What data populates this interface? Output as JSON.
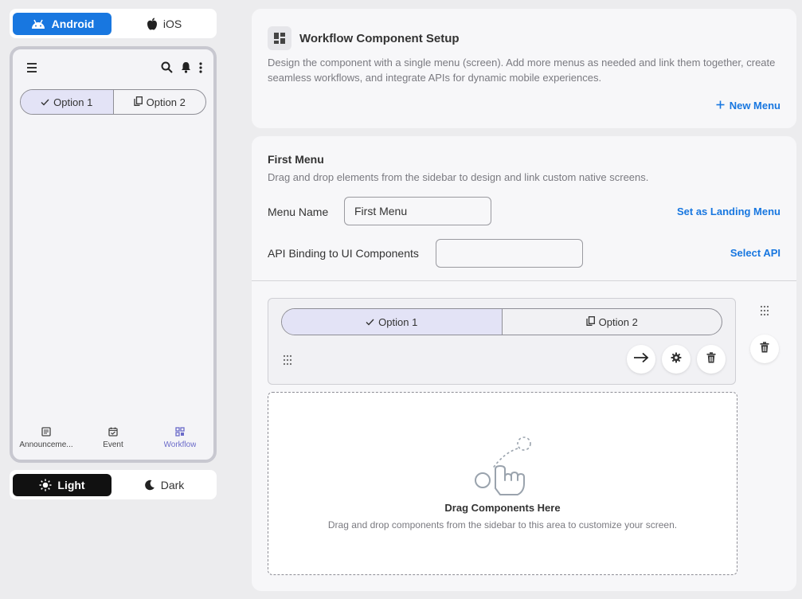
{
  "platform": {
    "android_label": "Android",
    "ios_label": "iOS",
    "selected": "Android"
  },
  "preview": {
    "tabs": [
      "Option 1",
      "Option 2"
    ],
    "selected_tab": "Option 1",
    "nav": [
      {
        "label": "Announceme...",
        "icon": "document-icon"
      },
      {
        "label": "Event",
        "icon": "calendar-check-icon"
      },
      {
        "label": "Workflow",
        "icon": "workflow-icon",
        "active": true
      }
    ]
  },
  "theme": {
    "light_label": "Light",
    "dark_label": "Dark",
    "selected": "Light"
  },
  "setup": {
    "title": "Workflow Component Setup",
    "description": "Design the component with a single menu (screen). Add more menus as needed and link them together, create seamless workflows, and integrate APIs for dynamic mobile experiences.",
    "new_menu_label": "New Menu"
  },
  "menu": {
    "title": "First Menu",
    "description": "Drag and drop elements from the sidebar to design and link custom native screens.",
    "name_label": "Menu Name",
    "name_value": "First Menu",
    "landing_label": "Set as Landing Menu",
    "api_label": "API Binding to UI Components",
    "api_value": "",
    "select_api_label": "Select API"
  },
  "component": {
    "tabs": [
      "Option 1",
      "Option 2"
    ],
    "selected_tab": "Option 1"
  },
  "dropzone": {
    "title": "Drag Components Here",
    "description": "Drag and drop components from the sidebar to this area to customize your screen."
  },
  "colors": {
    "accent": "#1877e0",
    "selected_tab_bg": "#e3e3f6",
    "nav_active": "#6b6bc9",
    "dark_button": "#111111"
  }
}
